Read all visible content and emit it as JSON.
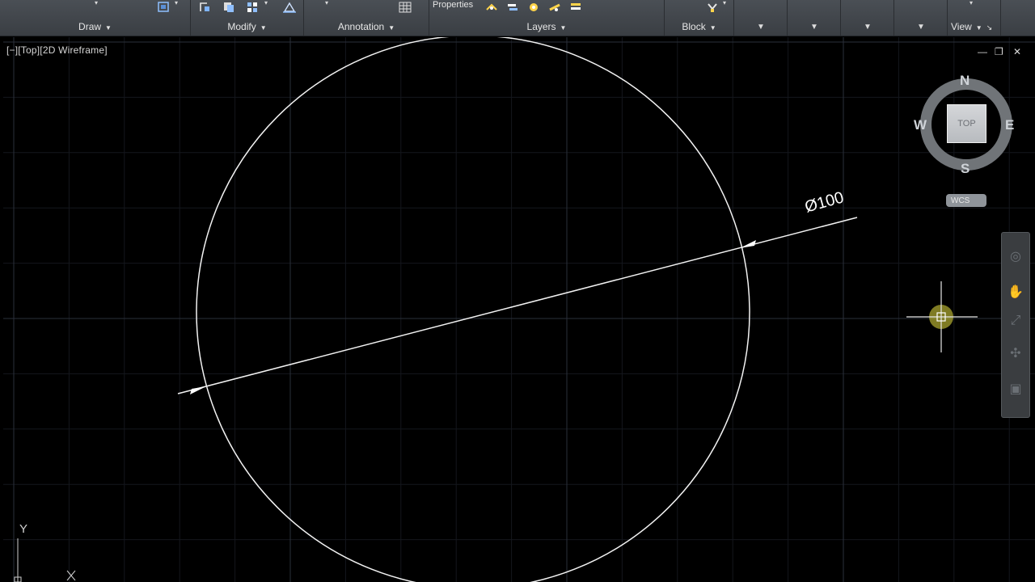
{
  "ribbon": {
    "panels": [
      {
        "name": "draw",
        "label": "Draw"
      },
      {
        "name": "modify",
        "label": "Modify"
      },
      {
        "name": "annotation",
        "label": "Annotation"
      },
      {
        "name": "layers",
        "label": "Layers"
      },
      {
        "name": "block",
        "label": "Block"
      },
      {
        "name": "view",
        "label": "View"
      }
    ],
    "properties_label": "Properties"
  },
  "viewport": {
    "label": "[−][Top][2D Wireframe]",
    "controls": {
      "minimize": "—",
      "restore": "❐",
      "close": "✕"
    }
  },
  "viewcube": {
    "north": "N",
    "south": "S",
    "east": "E",
    "west": "W",
    "face": "TOP",
    "wcs": "WCS"
  },
  "drawing": {
    "dimension_text": "Ø100"
  },
  "ucs": {
    "y_label": "Y",
    "x_label": "X"
  },
  "colors": {
    "background": "#000000",
    "grid_major": "#2a2f3a",
    "grid_minor": "#14171d",
    "cursor_glow": "#e8e040"
  }
}
